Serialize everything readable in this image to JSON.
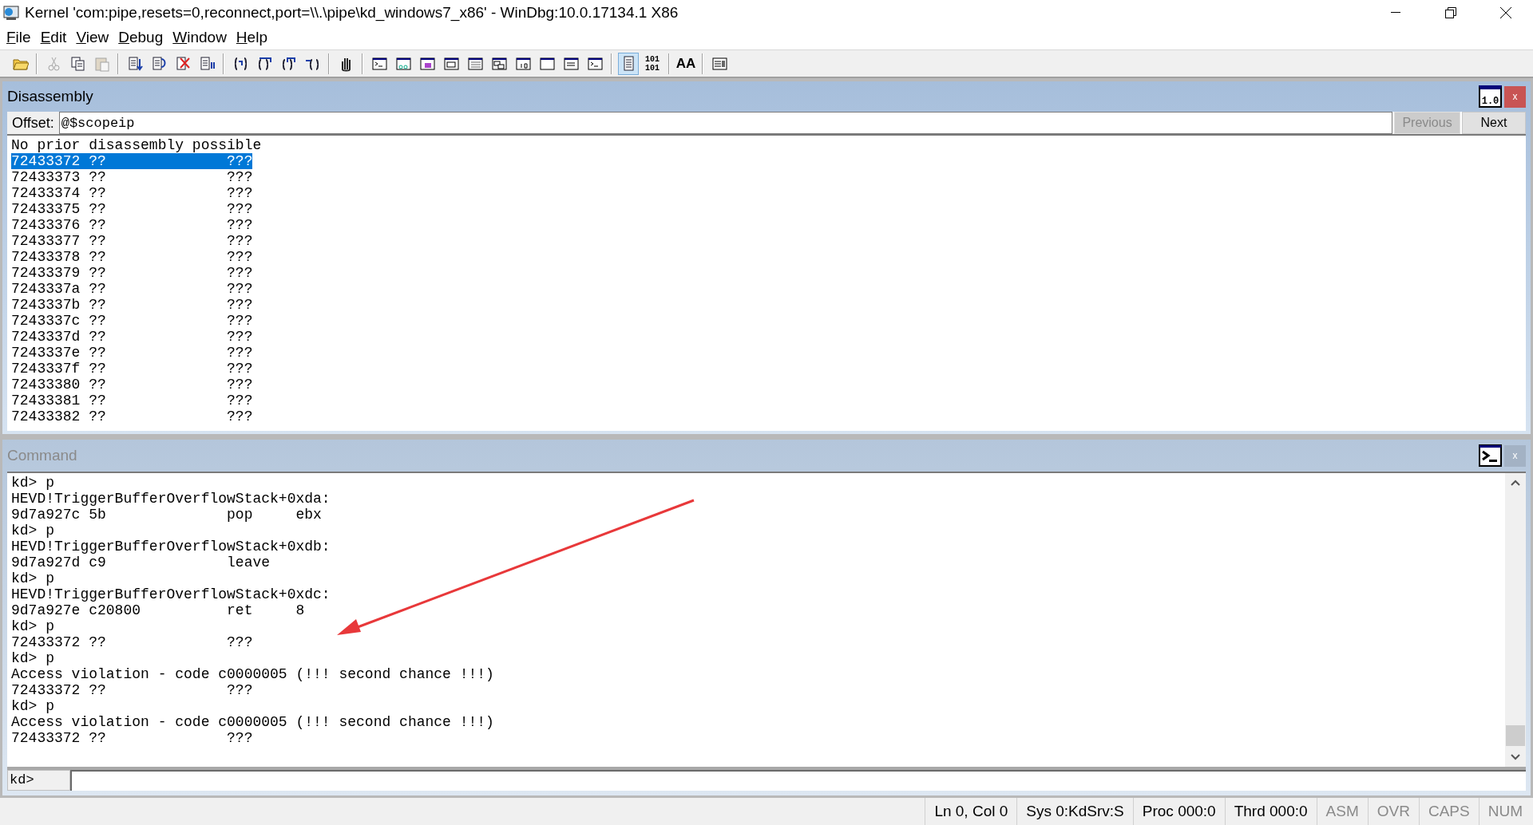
{
  "window": {
    "title": "Kernel 'com:pipe,resets=0,reconnect,port=\\\\.\\pipe\\kd_windows7_x86' - WinDbg:10.0.17134.1 X86"
  },
  "menu": [
    "File",
    "Edit",
    "View",
    "Debug",
    "Window",
    "Help"
  ],
  "toolbar": [
    {
      "kind": "icon",
      "disabled": false,
      "selected": false
    },
    {
      "kind": "separator"
    },
    {
      "kind": "icon",
      "disabled": true,
      "selected": false
    },
    {
      "kind": "icon",
      "disabled": false,
      "selected": false
    },
    {
      "kind": "icon",
      "disabled": true,
      "selected": false
    },
    {
      "kind": "separator"
    },
    {
      "kind": "icon",
      "disabled": false,
      "selected": false
    },
    {
      "kind": "icon",
      "disabled": false,
      "selected": false
    },
    {
      "kind": "icon",
      "disabled": false,
      "selected": false
    },
    {
      "kind": "icon",
      "disabled": false,
      "selected": false
    },
    {
      "kind": "separator"
    },
    {
      "kind": "icon",
      "disabled": false,
      "selected": false
    },
    {
      "kind": "icon",
      "disabled": false,
      "selected": false
    },
    {
      "kind": "icon",
      "disabled": false,
      "selected": false
    },
    {
      "kind": "icon",
      "disabled": false,
      "selected": false
    },
    {
      "kind": "separator"
    },
    {
      "kind": "icon",
      "disabled": false,
      "selected": false
    },
    {
      "kind": "separator"
    },
    {
      "kind": "icon",
      "disabled": false,
      "selected": false
    },
    {
      "kind": "icon",
      "disabled": false,
      "selected": false
    },
    {
      "kind": "icon",
      "disabled": false,
      "selected": false
    },
    {
      "kind": "icon",
      "disabled": false,
      "selected": false
    },
    {
      "kind": "icon",
      "disabled": false,
      "selected": false
    },
    {
      "kind": "icon",
      "disabled": false,
      "selected": false
    },
    {
      "kind": "icon",
      "disabled": false,
      "selected": false
    },
    {
      "kind": "icon",
      "disabled": false,
      "selected": false
    },
    {
      "kind": "icon",
      "disabled": false,
      "selected": false
    },
    {
      "kind": "icon",
      "disabled": false,
      "selected": false
    },
    {
      "kind": "separator"
    },
    {
      "kind": "icon",
      "disabled": false,
      "selected": true
    },
    {
      "kind": "text",
      "label": "101 101",
      "disabled": false,
      "selected": false
    },
    {
      "kind": "separator"
    },
    {
      "kind": "font",
      "label": "AA",
      "disabled": false,
      "selected": false
    },
    {
      "kind": "separator"
    },
    {
      "kind": "icon",
      "disabled": false,
      "selected": false
    }
  ],
  "disassembly": {
    "title": "Disassembly",
    "icon_label": "1.0",
    "close": "x",
    "offset_label": "Offset:",
    "offset_value": "@$scopeip",
    "previous": {
      "label": "Previous",
      "disabled": true
    },
    "next": {
      "label": "Next",
      "disabled": false
    },
    "lines": [
      {
        "text": "No prior disassembly possible",
        "selected": false
      },
      {
        "text": "72433372 ??              ???",
        "selected": true
      },
      {
        "text": "72433373 ??              ???",
        "selected": false
      },
      {
        "text": "72433374 ??              ???",
        "selected": false
      },
      {
        "text": "72433375 ??              ???",
        "selected": false
      },
      {
        "text": "72433376 ??              ???",
        "selected": false
      },
      {
        "text": "72433377 ??              ???",
        "selected": false
      },
      {
        "text": "72433378 ??              ???",
        "selected": false
      },
      {
        "text": "72433379 ??              ???",
        "selected": false
      },
      {
        "text": "7243337a ??              ???",
        "selected": false
      },
      {
        "text": "7243337b ??              ???",
        "selected": false
      },
      {
        "text": "7243337c ??              ???",
        "selected": false
      },
      {
        "text": "7243337d ??              ???",
        "selected": false
      },
      {
        "text": "7243337e ??              ???",
        "selected": false
      },
      {
        "text": "7243337f ??              ???",
        "selected": false
      },
      {
        "text": "72433380 ??              ???",
        "selected": false
      },
      {
        "text": "72433381 ??              ???",
        "selected": false
      },
      {
        "text": "72433382 ??              ???",
        "selected": false
      }
    ]
  },
  "command": {
    "title": "Command",
    "close": "x",
    "prompt": "kd>",
    "lines": [
      "kd> p",
      "HEVD!TriggerBufferOverflowStack+0xda:",
      "9d7a927c 5b              pop     ebx",
      "kd> p",
      "HEVD!TriggerBufferOverflowStack+0xdb:",
      "9d7a927d c9              leave",
      "kd> p",
      "HEVD!TriggerBufferOverflowStack+0xdc:",
      "9d7a927e c20800          ret     8",
      "kd> p",
      "72433372 ??              ???",
      "kd> p",
      "Access violation - code c0000005 (!!! second chance !!!)",
      "72433372 ??              ???",
      "kd> p",
      "Access violation - code c0000005 (!!! second chance !!!)",
      "72433372 ??              ???"
    ]
  },
  "status_bar": [
    {
      "text": "Ln 0, Col 0",
      "active": true
    },
    {
      "text": "Sys 0:KdSrv:S",
      "active": true
    },
    {
      "text": "Proc 000:0",
      "active": true
    },
    {
      "text": "Thrd 000:0",
      "active": true
    },
    {
      "text": "ASM",
      "active": false
    },
    {
      "text": "OVR",
      "active": false
    },
    {
      "text": "CAPS",
      "active": false
    },
    {
      "text": "NUM",
      "active": false
    }
  ]
}
